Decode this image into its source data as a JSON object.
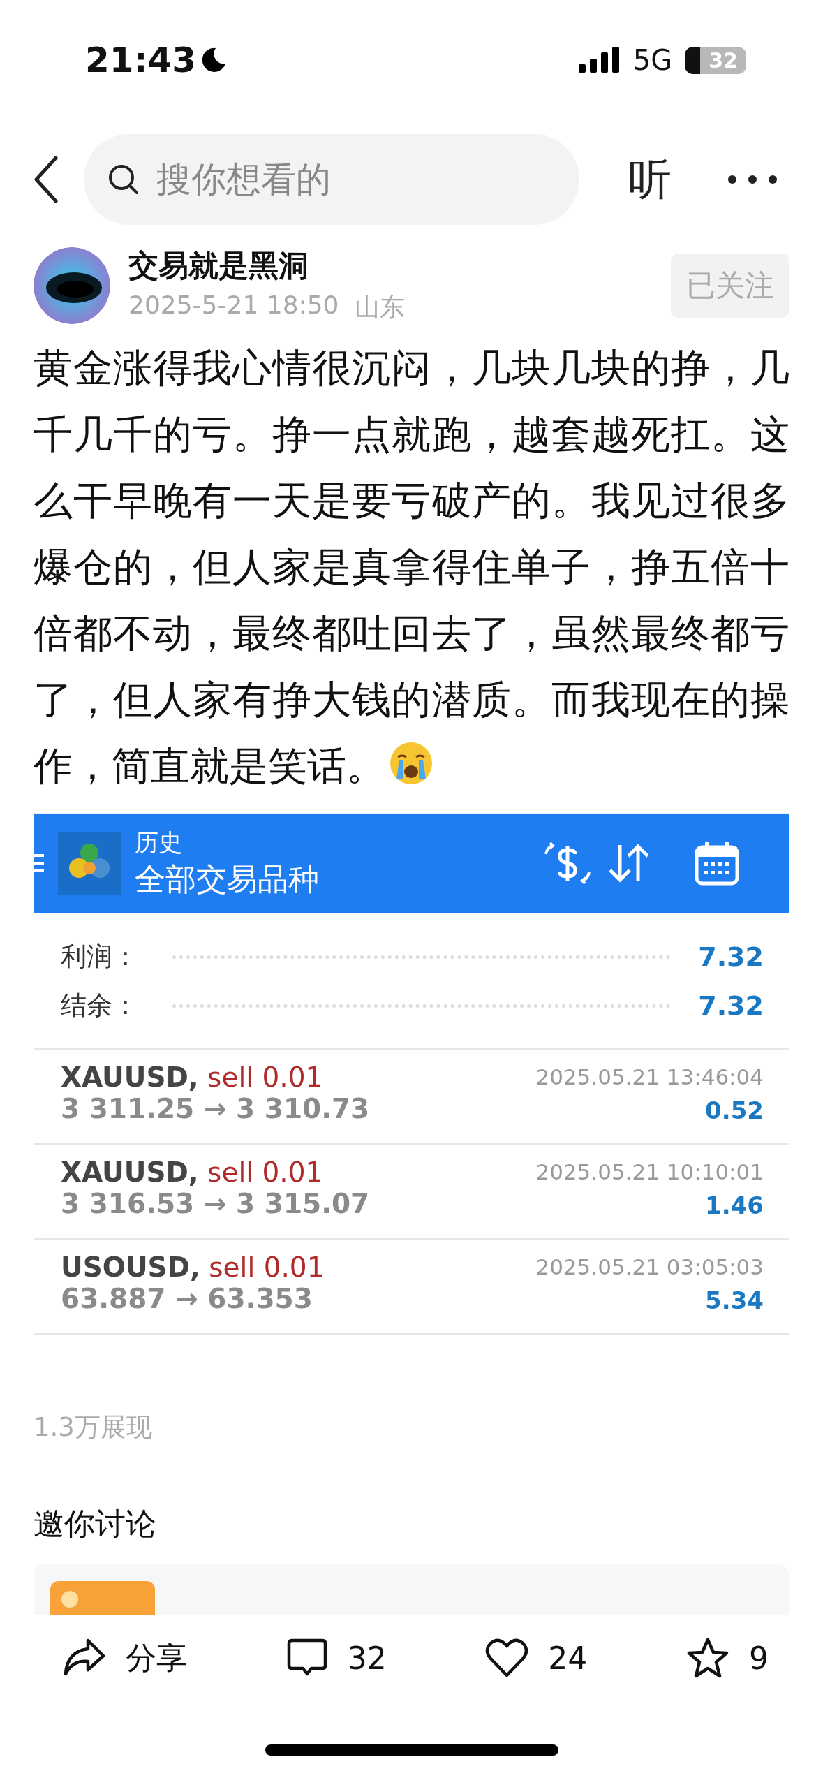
{
  "status_bar": {
    "time": "21:43",
    "network": "5G",
    "battery": "32"
  },
  "header": {
    "search": {
      "placeholder": "搜你想看的"
    },
    "listen": "听"
  },
  "author": {
    "name": "交易就是黑洞",
    "date": "2025-5-21 18:50",
    "location": "山东",
    "follow_button": "已关注"
  },
  "post": {
    "text": "黄金涨得我心情很沉闷，几块几块的挣，几千几千的亏。挣一点就跑，越套越死扛。这么干早晚有一天是要亏破产的。我见过很多爆仓的，但人家是真拿得住单子，挣五倍十倍都不动，最终都吐回去了，虽然最终都亏了，但人家有挣大钱的潜质。而我现在的操作，简直就是笑话。"
  },
  "trade_screenshot": {
    "title": "历史",
    "subtitle": "全部交易品种",
    "summary": [
      {
        "label": "利润：",
        "value": "7.32"
      },
      {
        "label": "结余：",
        "value": "7.32"
      }
    ],
    "trades": [
      {
        "symbol": "XAUUSD,",
        "side": "sell 0.01",
        "prices": "3 311.25 → 3 310.73",
        "time": "2025.05.21 13:46:04",
        "profit": "0.52"
      },
      {
        "symbol": "XAUUSD,",
        "side": "sell 0.01",
        "prices": "3 316.53 → 3 315.07",
        "time": "2025.05.21 10:10:01",
        "profit": "1.46"
      },
      {
        "symbol": "USOUSD,",
        "side": "sell 0.01",
        "prices": "63.887 → 63.353",
        "time": "2025.05.21 03:05:03",
        "profit": "5.34"
      }
    ]
  },
  "views": "1.3万展现",
  "discussion": {
    "heading": "邀你讨论"
  },
  "actions": [
    {
      "kind": "share",
      "label": "分享"
    },
    {
      "kind": "comment",
      "label": "32"
    },
    {
      "kind": "like",
      "label": "24"
    },
    {
      "kind": "star",
      "label": "9"
    }
  ]
}
